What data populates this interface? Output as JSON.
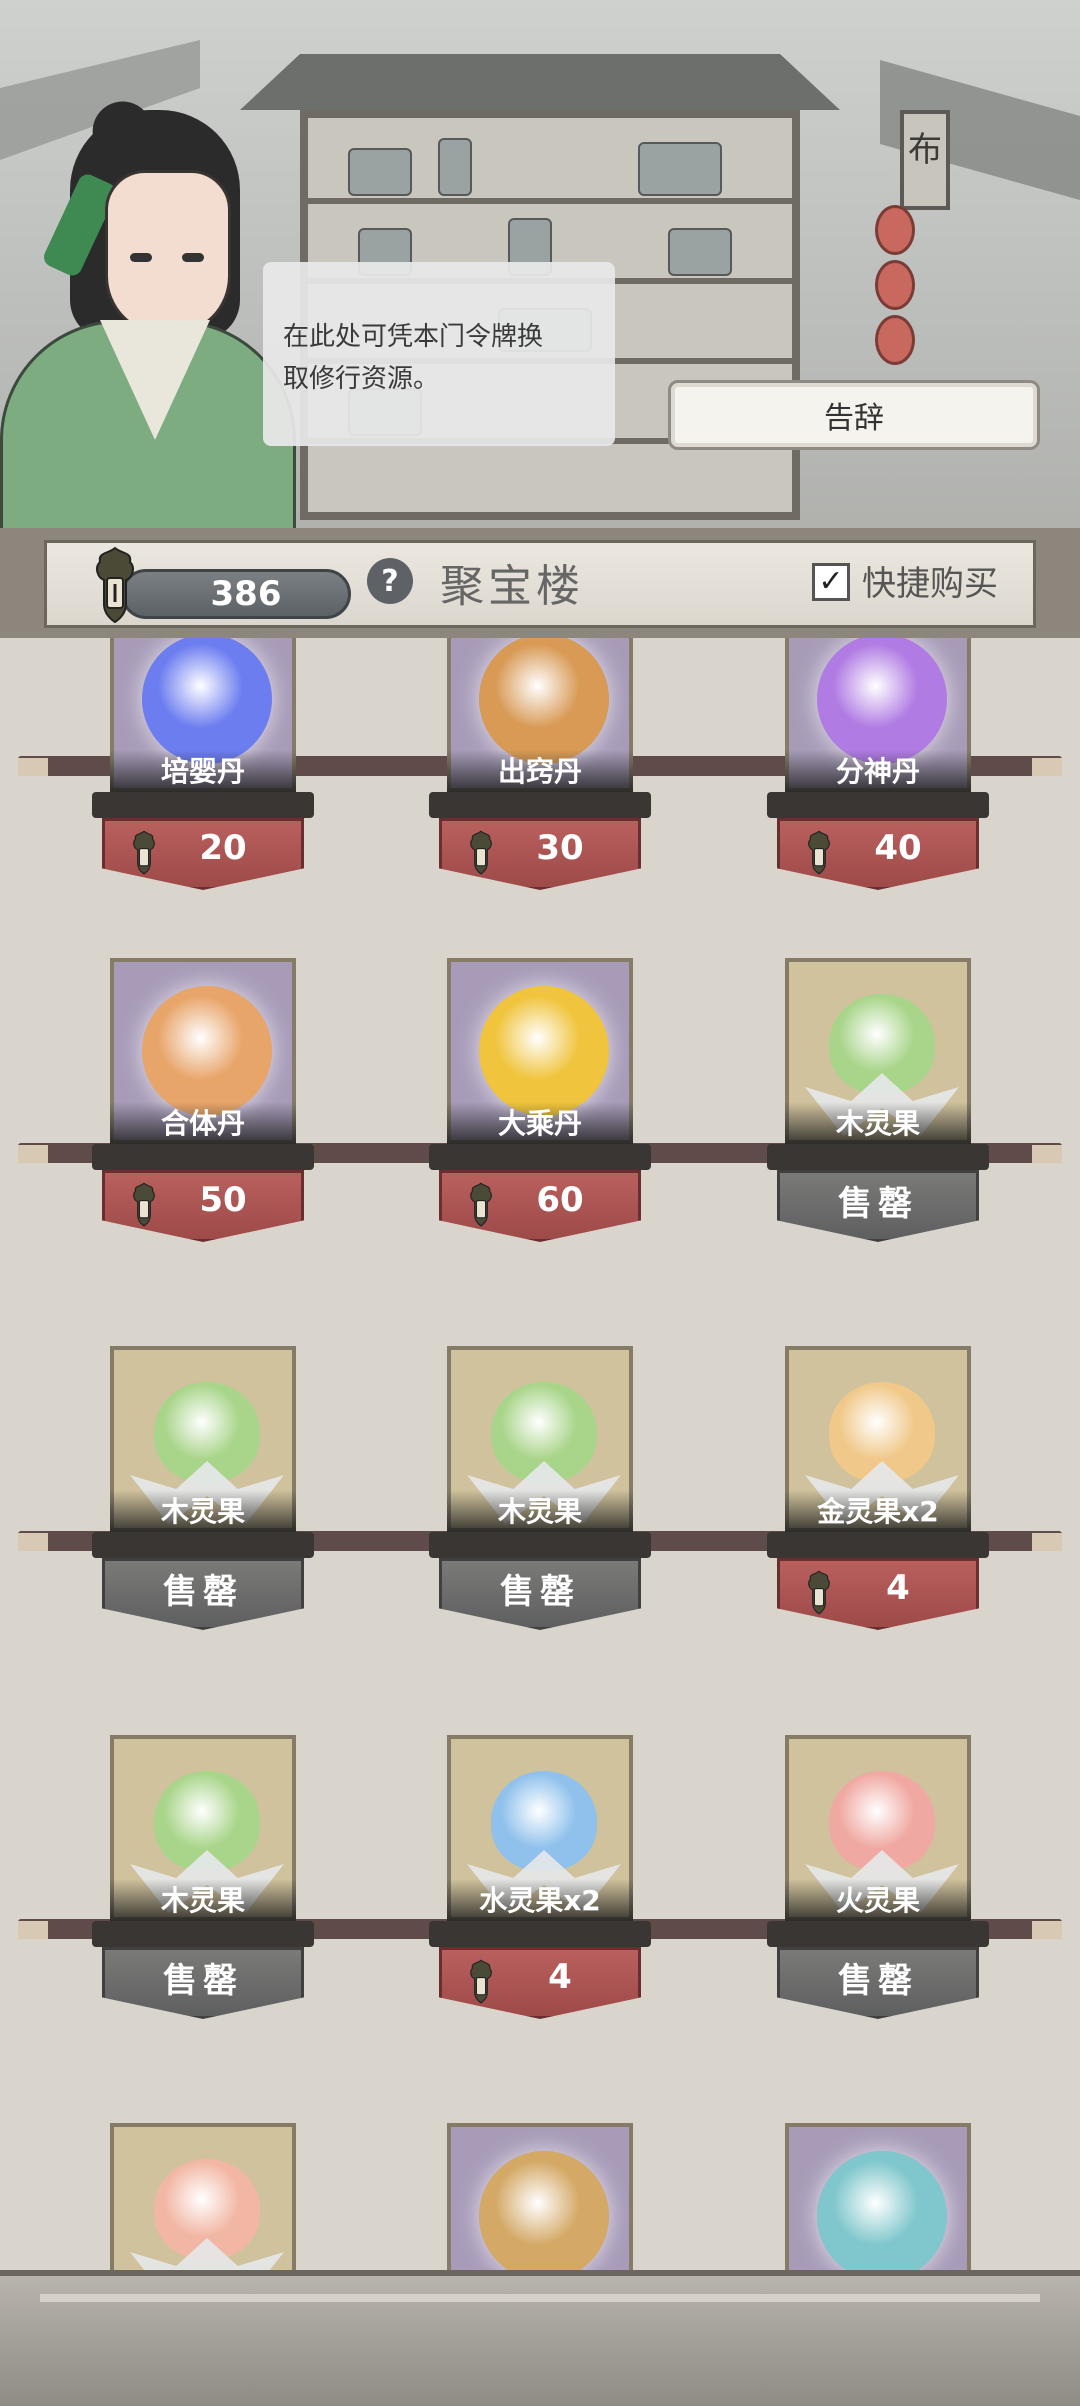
{
  "npc": {
    "dialog_line1": "在此处可凭本门令牌换",
    "dialog_line2": "取修行资源。"
  },
  "scene": {
    "sign_text": "布"
  },
  "buttons": {
    "leave": "告辞"
  },
  "header": {
    "token_count": "386",
    "help": "?",
    "title": "聚宝楼",
    "quick_buy_label": "快捷购买",
    "quick_buy_checked": true
  },
  "colors": {
    "price_red": "#a24f4d",
    "soldout_gray": "#6a6a69",
    "fruit_card": "#cfc29c",
    "pill_card": "#a79bb8"
  },
  "items": [
    {
      "name": "培婴丹",
      "price": "20",
      "sold_out": false,
      "kind": "pill",
      "color": "#6c7df0"
    },
    {
      "name": "出窍丹",
      "price": "30",
      "sold_out": false,
      "kind": "pill",
      "color": "#d89a55"
    },
    {
      "name": "分神丹",
      "price": "40",
      "sold_out": false,
      "kind": "pill",
      "color": "#b07be3"
    },
    {
      "name": "合体丹",
      "price": "50",
      "sold_out": false,
      "kind": "pill",
      "color": "#e8a56a"
    },
    {
      "name": "大乘丹",
      "price": "60",
      "sold_out": false,
      "kind": "pill",
      "color": "#f0c43c"
    },
    {
      "name": "木灵果",
      "price": "售罄",
      "sold_out": true,
      "kind": "fruit",
      "color": "#a9d58a"
    },
    {
      "name": "木灵果",
      "price": "售罄",
      "sold_out": true,
      "kind": "fruit",
      "color": "#a9d58a"
    },
    {
      "name": "木灵果",
      "price": "售罄",
      "sold_out": true,
      "kind": "fruit",
      "color": "#a9d58a"
    },
    {
      "name": "金灵果x2",
      "price": "4",
      "sold_out": false,
      "kind": "fruit",
      "color": "#f0c98a"
    },
    {
      "name": "木灵果",
      "price": "售罄",
      "sold_out": true,
      "kind": "fruit",
      "color": "#a9d58a"
    },
    {
      "name": "水灵果x2",
      "price": "4",
      "sold_out": false,
      "kind": "fruit",
      "color": "#8fc1ec"
    },
    {
      "name": "火灵果",
      "price": "售罄",
      "sold_out": true,
      "kind": "fruit",
      "color": "#f0a9a2"
    },
    {
      "name": "",
      "price": "",
      "sold_out": false,
      "kind": "fruit",
      "color": "#f2b7a4"
    },
    {
      "name": "",
      "price": "",
      "sold_out": false,
      "kind": "pill",
      "color": "#d4a966"
    },
    {
      "name": "",
      "price": "",
      "sold_out": false,
      "kind": "pill",
      "color": "#7fc7cc"
    }
  ]
}
